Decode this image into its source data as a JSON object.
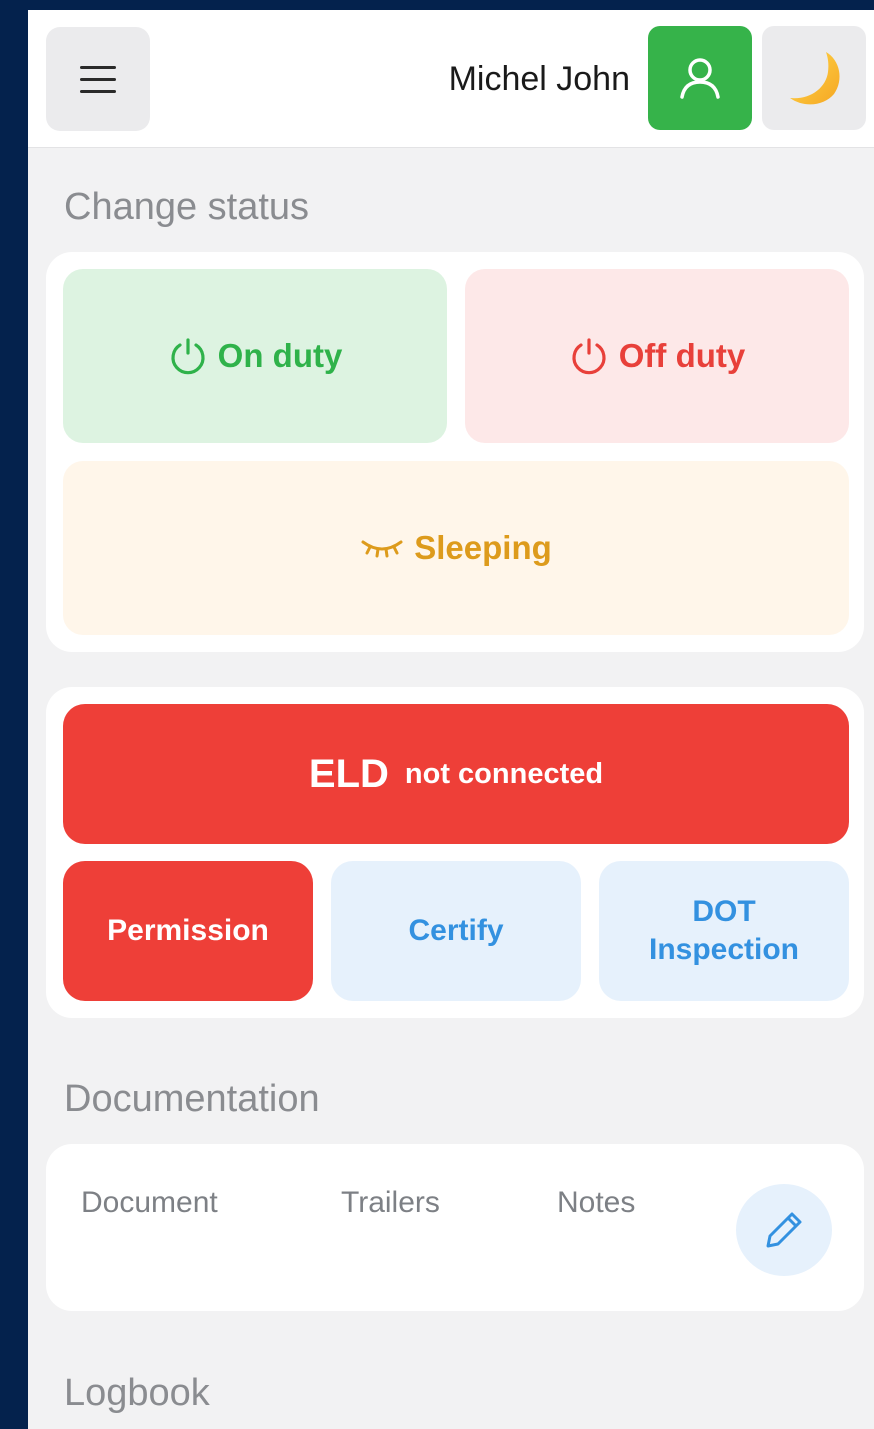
{
  "header": {
    "user_name": "Michel John",
    "menu_icon": "hamburger-icon",
    "profile_icon": "user-icon",
    "theme_icon": "moon-icon"
  },
  "change_status": {
    "title": "Change status",
    "on_duty": "On duty",
    "off_duty": "Off duty",
    "sleeping": "Sleeping"
  },
  "eld": {
    "label": "ELD",
    "status": "not connected"
  },
  "actions": {
    "permission": "Permission",
    "certify": "Certify",
    "dot_line1": "DOT",
    "dot_line2": "Inspection"
  },
  "documentation": {
    "title": "Documentation",
    "tabs": [
      "Document",
      "Trailers",
      "Notes"
    ],
    "edit_icon": "pencil-icon"
  },
  "logbook": {
    "title": "Logbook"
  },
  "colors": {
    "frame": "#04224d",
    "green": "#36b34a",
    "red": "#ee3f38",
    "amber": "#dd9b1c",
    "blue": "#3391e0"
  }
}
